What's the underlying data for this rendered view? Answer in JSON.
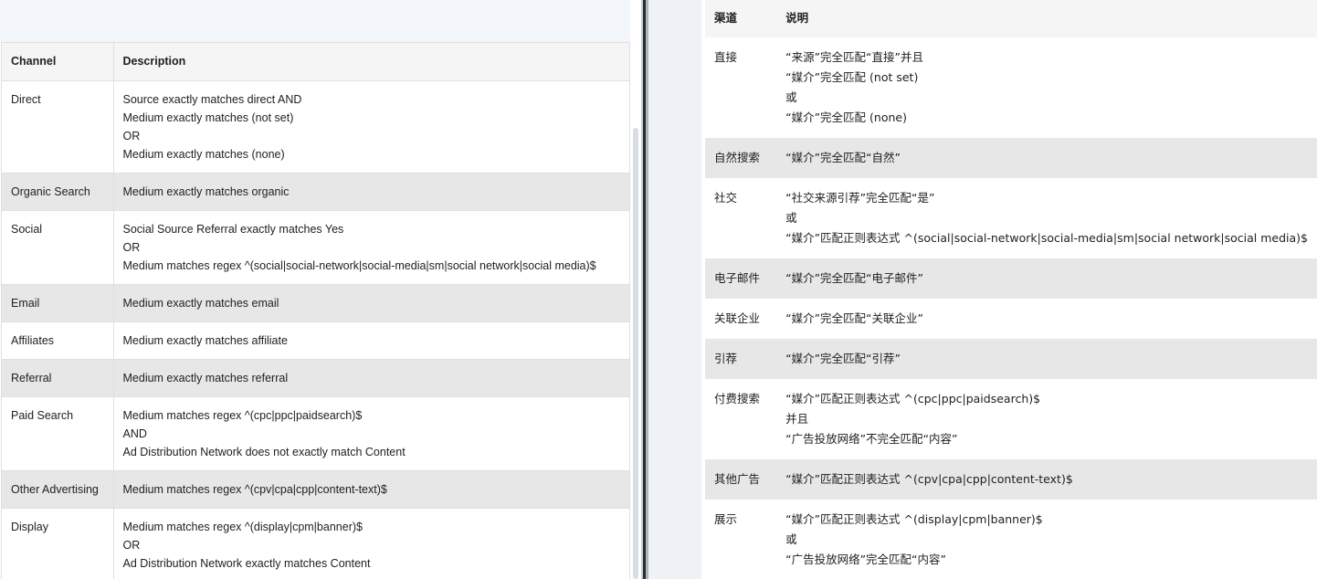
{
  "left": {
    "headers": {
      "channel": "Channel",
      "description": "Description"
    },
    "rows": [
      {
        "channel": "Direct",
        "lines": [
          "Source exactly matches direct AND",
          "Medium exactly matches (not set)",
          "OR",
          "Medium exactly matches (none)"
        ]
      },
      {
        "channel": "Organic Search",
        "lines": [
          "Medium exactly matches organic"
        ]
      },
      {
        "channel": "Social",
        "lines": [
          "Social Source Referral exactly matches Yes",
          "OR",
          "Medium matches regex ^(social|social-network|social-media|sm|social network|social media)$"
        ]
      },
      {
        "channel": "Email",
        "lines": [
          "Medium exactly matches email"
        ]
      },
      {
        "channel": "Affiliates",
        "lines": [
          "Medium exactly matches affiliate"
        ]
      },
      {
        "channel": "Referral",
        "lines": [
          "Medium exactly matches referral"
        ]
      },
      {
        "channel": "Paid Search",
        "lines": [
          "Medium matches regex ^(cpc|ppc|paidsearch)$",
          "AND",
          "Ad Distribution Network does not exactly match Content"
        ]
      },
      {
        "channel": "Other Advertising",
        "lines": [
          "Medium matches regex ^(cpv|cpa|cpp|content-text)$"
        ]
      },
      {
        "channel": "Display",
        "lines": [
          "Medium matches regex ^(display|cpm|banner)$",
          "OR",
          "Ad Distribution Network exactly matches Content"
        ]
      }
    ]
  },
  "right": {
    "headers": {
      "channel": "渠道",
      "description": "说明"
    },
    "rows": [
      {
        "channel": "直接",
        "lines": [
          "“来源”完全匹配“直接”并且",
          "“媒介”完全匹配 (not set)",
          "或",
          "“媒介”完全匹配 (none)"
        ]
      },
      {
        "channel": "自然搜索",
        "lines": [
          "“媒介”完全匹配“自然”"
        ]
      },
      {
        "channel": "社交",
        "lines": [
          "“社交来源引荐”完全匹配“是”",
          "或",
          "“媒介”匹配正则表达式 ^(social|social-network|social-media|sm|social network|social media)$"
        ]
      },
      {
        "channel": "电子邮件",
        "lines": [
          "“媒介”完全匹配“电子邮件”"
        ]
      },
      {
        "channel": "关联企业",
        "lines": [
          "“媒介”完全匹配“关联企业”"
        ]
      },
      {
        "channel": "引荐",
        "lines": [
          "“媒介”完全匹配“引荐”"
        ]
      },
      {
        "channel": "付费搜索",
        "lines": [
          "“媒介”匹配正则表达式 ^(cpc|ppc|paidsearch)$",
          "并且",
          "“广告投放网络”不完全匹配“内容”"
        ]
      },
      {
        "channel": "其他广告",
        "lines": [
          "“媒介”匹配正则表达式 ^(cpv|cpa|cpp|content-text)$"
        ]
      },
      {
        "channel": "展示",
        "lines": [
          "“媒介”匹配正则表达式 ^(display|cpm|banner)$",
          "或",
          "“广告投放网络”完全匹配“内容”"
        ]
      }
    ]
  },
  "colors": {
    "header_bg": "#f5f5f5",
    "shade_row_bg": "#e7e7e7",
    "border": "#e0e0e0",
    "text": "#212121"
  }
}
